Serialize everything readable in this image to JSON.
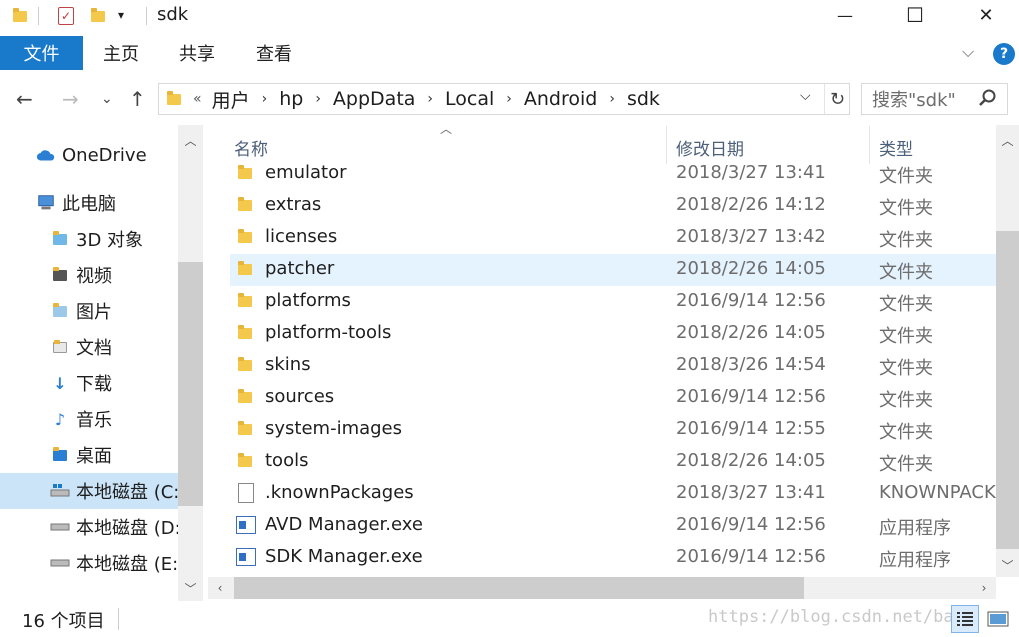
{
  "window": {
    "title": "sdk",
    "minimize": "—",
    "maximize": "☐",
    "close": "✕"
  },
  "ribbon": {
    "file_tab": "文件",
    "tabs": [
      "主页",
      "共享",
      "查看"
    ],
    "help": "?"
  },
  "navigation": {
    "back": "←",
    "forward": "→",
    "recent": "⌄",
    "up": "↑",
    "breadcrumb_overflow": "«",
    "breadcrumb": [
      "用户",
      "hp",
      "AppData",
      "Local",
      "Android",
      "sdk"
    ],
    "search_placeholder": "搜索\"sdk\""
  },
  "sidebar": {
    "items": [
      {
        "label": "OneDrive",
        "icon": "cloud-icon",
        "selected": false
      },
      {
        "label": "此电脑",
        "icon": "computer-icon",
        "selected": false
      },
      {
        "label": "3D 对象",
        "icon": "folder-3d-icon",
        "selected": false
      },
      {
        "label": "视频",
        "icon": "folder-video-icon",
        "selected": false
      },
      {
        "label": "图片",
        "icon": "folder-pictures-icon",
        "selected": false
      },
      {
        "label": "文档",
        "icon": "folder-documents-icon",
        "selected": false
      },
      {
        "label": "下载",
        "icon": "folder-downloads-icon",
        "selected": false
      },
      {
        "label": "音乐",
        "icon": "folder-music-icon",
        "selected": false
      },
      {
        "label": "桌面",
        "icon": "folder-desktop-icon",
        "selected": false
      },
      {
        "label": "本地磁盘 (C:",
        "icon": "drive-windows-icon",
        "selected": true
      },
      {
        "label": "本地磁盘 (D:",
        "icon": "drive-icon",
        "selected": false
      },
      {
        "label": "本地磁盘 (E:)",
        "icon": "drive-icon",
        "selected": false
      }
    ]
  },
  "columns": {
    "name": "名称",
    "date": "修改日期",
    "type": "类型"
  },
  "files": [
    {
      "name": "emulator",
      "date": "2018/3/27 13:41",
      "type": "文件夹",
      "icon": "folder-icon"
    },
    {
      "name": "extras",
      "date": "2018/2/26 14:12",
      "type": "文件夹",
      "icon": "folder-icon"
    },
    {
      "name": "licenses",
      "date": "2018/3/27 13:42",
      "type": "文件夹",
      "icon": "folder-icon"
    },
    {
      "name": "patcher",
      "date": "2018/2/26 14:05",
      "type": "文件夹",
      "icon": "folder-icon"
    },
    {
      "name": "platforms",
      "date": "2016/9/14 12:56",
      "type": "文件夹",
      "icon": "folder-icon"
    },
    {
      "name": "platform-tools",
      "date": "2018/2/26 14:05",
      "type": "文件夹",
      "icon": "folder-icon"
    },
    {
      "name": "skins",
      "date": "2018/3/26 14:54",
      "type": "文件夹",
      "icon": "folder-icon"
    },
    {
      "name": "sources",
      "date": "2016/9/14 12:56",
      "type": "文件夹",
      "icon": "folder-icon"
    },
    {
      "name": "system-images",
      "date": "2016/9/14 12:55",
      "type": "文件夹",
      "icon": "folder-icon"
    },
    {
      "name": "tools",
      "date": "2018/2/26 14:05",
      "type": "文件夹",
      "icon": "folder-icon"
    },
    {
      "name": ".knownPackages",
      "date": "2018/3/27 13:41",
      "type": "KNOWNPACKAGES",
      "icon": "file-icon"
    },
    {
      "name": "AVD Manager.exe",
      "date": "2016/9/14 12:56",
      "type": "应用程序",
      "icon": "exe-icon"
    },
    {
      "name": "SDK Manager.exe",
      "date": "2016/9/14 12:56",
      "type": "应用程序",
      "icon": "exe-icon"
    }
  ],
  "status": {
    "item_count": "16 个项目",
    "watermark": "https://blog.csdn.net/ba"
  },
  "colors": {
    "accent": "#1979ca",
    "hover_row": "#e5f3ff",
    "selected_nav": "#cce4f7",
    "folder": "#f4c84a"
  }
}
